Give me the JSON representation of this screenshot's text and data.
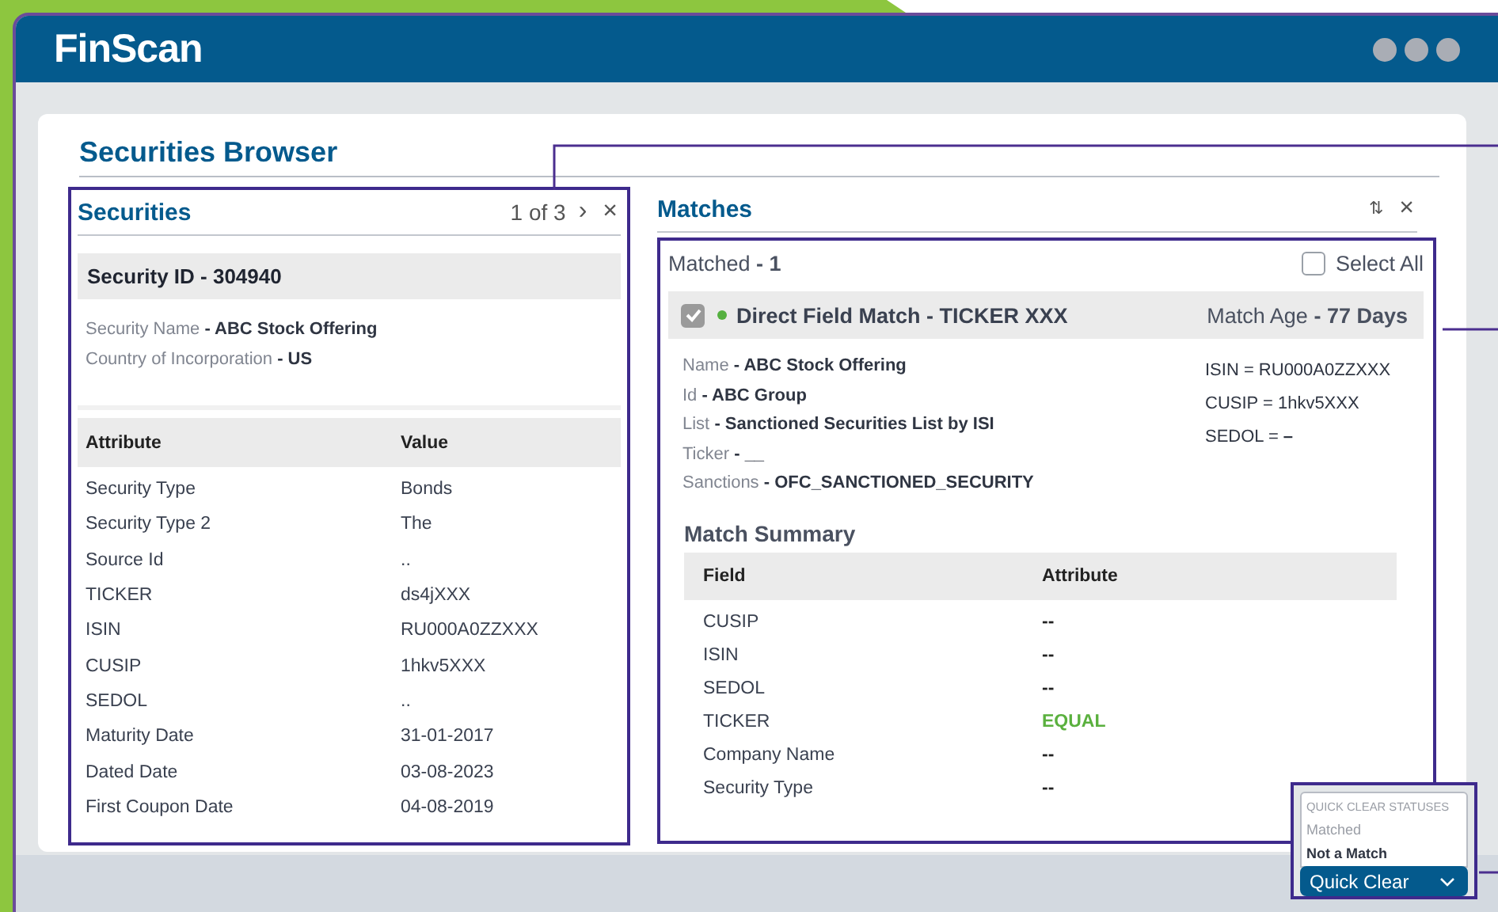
{
  "app": {
    "logo": "FinScan"
  },
  "page": {
    "title": "Securities Browser"
  },
  "securities": {
    "title": "Securities",
    "pager": "1 of 3",
    "next": "›",
    "close": "×",
    "header": "Security ID - 304940",
    "details": [
      "Security Name **- ABC Stock Offering**",
      "Country of Incorporation **- US**"
    ],
    "columns": [
      "Attribute",
      "Value"
    ],
    "rows": [
      [
        "Security Type",
        "Bonds"
      ],
      [
        "Security Type 2",
        "The"
      ],
      [
        "Source Id",
        ".."
      ],
      [
        "TICKER",
        "ds4jXXX"
      ],
      [
        "ISIN",
        "RU000A0ZZXXX"
      ],
      [
        "CUSIP",
        "1hkv5XXX"
      ],
      [
        "SEDOL",
        ".."
      ],
      [
        "Maturity Date",
        "31-01-2017"
      ],
      [
        "Dated Date",
        "03-08-2023"
      ],
      [
        "First Coupon Date",
        "04-08-2019"
      ]
    ]
  },
  "matches": {
    "title": "Matches",
    "sort": "⇅",
    "close": "×",
    "matched": "Matched **- 1**",
    "select_all": {
      "label": "Select All",
      "checked": false
    },
    "match": {
      "checked": true,
      "title": "Direct Field Match - TICKER XXX",
      "age": "Match Age **- 77 Days**",
      "details": [
        "Name **- ABC Stock Offering**",
        "Id **- ABC Group**",
        "List **- Sanctioned Securities List  by ISI**",
        "Ticker **- __**",
        "Sanctions **- OFC_SANCTIONED_SECURITY**"
      ],
      "identifiers": [
        "ISIN = RU000A0ZZXXX",
        "CUSIP = 1hkv5XXX",
        "SEDOL = **–**"
      ]
    },
    "summary": {
      "title": "Match Summary",
      "columns": [
        "Field",
        "Attribute"
      ],
      "rows": [
        {
          "field": "CUSIP",
          "attribute": "--",
          "kind": "none"
        },
        {
          "field": "ISIN",
          "attribute": "--",
          "kind": "none"
        },
        {
          "field": "SEDOL",
          "attribute": "--",
          "kind": "none"
        },
        {
          "field": "TICKER",
          "attribute": "EQUAL",
          "kind": "equal"
        },
        {
          "field": "Company Name",
          "attribute": "--",
          "kind": "none"
        },
        {
          "field": "Security Type",
          "attribute": "--",
          "kind": "none"
        }
      ]
    }
  },
  "quick_clear": {
    "heading": "QUICK CLEAR STATUSES",
    "options": [
      {
        "label": "Matched",
        "selected": false
      },
      {
        "label": "Not a Match",
        "selected": true
      }
    ],
    "button": "Quick Clear"
  }
}
